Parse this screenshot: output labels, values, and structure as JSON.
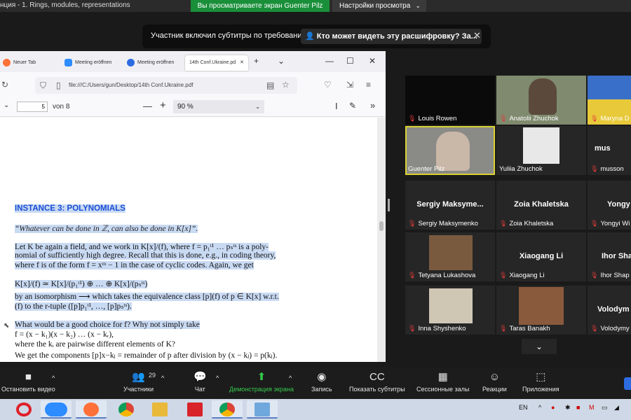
{
  "topbar": {
    "title": "нция - 1. Rings, modules, representations",
    "share_text": "Вы просматриваете экран Guenter Pilz",
    "view_options": "Настройки просмотра"
  },
  "banner": {
    "message": "Участник включил субтитры по требованию",
    "who_can_see": "Кто может видеть эту расшифровку? За..."
  },
  "browser": {
    "tabs": [
      {
        "label": "Neuer Tab"
      },
      {
        "label": "Meeting eröffnen"
      },
      {
        "label": "Meeting eröffnen"
      },
      {
        "label": "14th Conf.Ukraine.pd"
      }
    ],
    "new_tab": "+",
    "url": "file:///C:/Users/gun/Desktop/14th Conf.Ukraine.pdf",
    "page_number": "5",
    "page_total": "von 8",
    "zoom": "90 %"
  },
  "document": {
    "heading": "INSTANCE 3: POLYNOMIALS",
    "quote": "“Whatever can be done in ℤ, can also be done in K[x]”.",
    "lines": [
      "Let K be again a field, and we work in K[x]/(f), where f = p₁ᵗ¹ … pₛᵗˢ is a poly-",
      "nomial of sufficiently high degree. Recall that this is done, e.g., in coding theory,",
      "where f is of the form f = xᵐ − 1 in the case of cyclic codes. Again, we get",
      "K[x]/(f) ≃ K[x]/(p₁ᵗ¹) ⊕ … ⊕ K[x]/(pₛᵗˢ)",
      "by an isomorphism ⟶ which takes the equivalence class [p](f) of p ∈ K[x] w.r.t.",
      "(f) to the r-tuple ([p]p₁ᵗ¹, …, [p]pₛᵗˢ).",
      "What would be a good choice for f? Why not simply take",
      "f = (x − k₁)(x − k₂) … (x − kᵣ),",
      "where the kᵢ are pairwise different elements of K?",
      "We get the components [p]x−kⱼ = remainder of p after division by (x − kⱼ) = p(kⱼ)."
    ]
  },
  "participants": [
    {
      "name": "Louis Rowen",
      "big": ""
    },
    {
      "name": "Anatolii Zhuchok",
      "big": ""
    },
    {
      "name": "Maryna D",
      "big": ""
    },
    {
      "name": "Guenter Pilz",
      "big": ""
    },
    {
      "name": "Yuliia Zhuchok",
      "big": ""
    },
    {
      "name": "musson",
      "big": "mus"
    },
    {
      "name": "Sergiy Maksymenko",
      "big": "Sergiy Maksyme..."
    },
    {
      "name": "Zoia Khaletska",
      "big": "Zoia Khaletska"
    },
    {
      "name": "Yongyi Wi",
      "big": "Yongy"
    },
    {
      "name": "Tetyana Lukashova",
      "big": ""
    },
    {
      "name": "Xiaogang Li",
      "big": "Xiaogang Li"
    },
    {
      "name": "Ihor Shap",
      "big": "Ihor Sha"
    },
    {
      "name": "Inna Shyshenko",
      "big": ""
    },
    {
      "name": "Taras Banakh",
      "big": ""
    },
    {
      "name": "Volodymy",
      "big": "Volodym"
    }
  ],
  "toolbar": {
    "stop_video": "Остановить видео",
    "participants": "Участники",
    "participants_count": "29",
    "chat": "Чат",
    "share": "Демонстрация экрана",
    "record": "Запись",
    "subtitles": "Показать субтитры",
    "rooms": "Сессионные залы",
    "reactions": "Реакции",
    "apps": "Приложения"
  },
  "taskbar": {
    "lang": "EN"
  },
  "colors": {
    "share_green": "#1a8f3a",
    "heading_blue": "#1a4fd6",
    "highlight": "#c9daf3",
    "active_speaker": "#d9d232"
  }
}
